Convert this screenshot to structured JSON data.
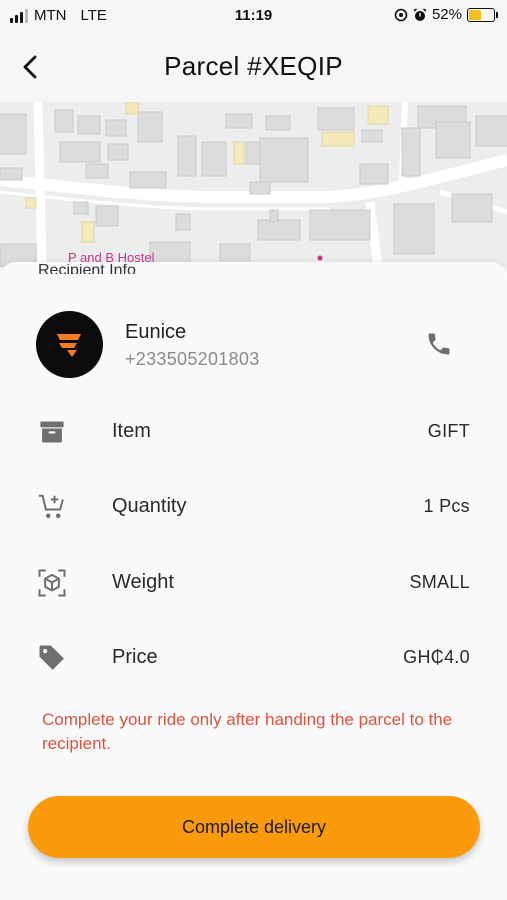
{
  "status_bar": {
    "carrier": "MTN",
    "network": "LTE",
    "time": "11:19",
    "battery": "52%",
    "battery_level": 0.52,
    "icons": [
      "signal-icon",
      "location-icon",
      "alarm-icon",
      "battery-icon"
    ]
  },
  "header": {
    "title": "Parcel #XEQIP",
    "back_icon": "chevron-left-icon"
  },
  "map": {
    "place_label": "P and B Hostel"
  },
  "recipient": {
    "section_title": "Recipient Info",
    "name": "Eunice",
    "phone": "+233505201803",
    "call_icon": "phone-icon"
  },
  "details": [
    {
      "icon": "archive-box-icon",
      "label": "Item",
      "value": "GIFT"
    },
    {
      "icon": "cart-add-icon",
      "label": "Quantity",
      "value": "1 Pcs"
    },
    {
      "icon": "cube-scan-icon",
      "label": "Weight",
      "value": "SMALL"
    },
    {
      "icon": "price-tag-icon",
      "label": "Price",
      "value": "GH₵4.0"
    }
  ],
  "warning": "Complete your ride only after handing the parcel to the recipient.",
  "action": {
    "label": "Complete delivery"
  },
  "colors": {
    "accent": "#fb9b0c",
    "warning": "#e0513f",
    "icon": "#6f6f6f",
    "map_label": "#c8388d"
  }
}
